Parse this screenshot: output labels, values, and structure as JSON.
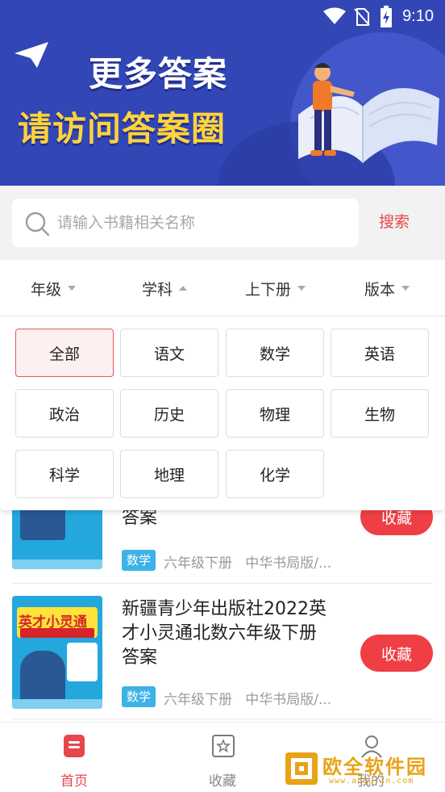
{
  "status_bar": {
    "time": "9:10"
  },
  "banner": {
    "line1": "更多答案",
    "line2": "请访问答案圈"
  },
  "search": {
    "placeholder": "请输入书籍相关名称",
    "button_label": "搜索"
  },
  "filters": [
    {
      "label": "年级",
      "state": "collapsed"
    },
    {
      "label": "学科",
      "state": "expanded"
    },
    {
      "label": "上下册",
      "state": "collapsed"
    },
    {
      "label": "版本",
      "state": "collapsed"
    }
  ],
  "subject_options": {
    "selected": "全部",
    "items": [
      "全部",
      "语文",
      "数学",
      "英语",
      "政治",
      "历史",
      "物理",
      "生物",
      "科学",
      "地理",
      "化学"
    ]
  },
  "books": [
    {
      "title": "答案",
      "subject": "数学",
      "grade": "六年级下册",
      "edition": "中华书局版/...",
      "action": "收藏"
    },
    {
      "title": "新疆青少年出版社2022英才小灵通北数六年级下册答案",
      "title_lines": [
        "新疆青少年出版社2022英",
        "才小灵通北数六年级下册",
        "答案"
      ],
      "cover_title": "英才小灵通",
      "subject": "数学",
      "grade": "六年级下册",
      "edition": "中华书局版/...",
      "action": "收藏"
    }
  ],
  "bottom_nav": {
    "tabs": [
      {
        "label": "首页",
        "icon": "home-book-icon",
        "active": true
      },
      {
        "label": "收藏",
        "icon": "star-box-icon",
        "active": false
      },
      {
        "label": "我的",
        "icon": "user-icon",
        "active": false
      }
    ]
  },
  "watermark": {
    "text": "欧全软件园",
    "url": "www.apoujin.com"
  },
  "colors": {
    "banner_blue": "#3346b6",
    "accent_red": "#ef3f44",
    "tag_blue": "#3cb3e6",
    "banner_yellow": "#ffd33b"
  }
}
